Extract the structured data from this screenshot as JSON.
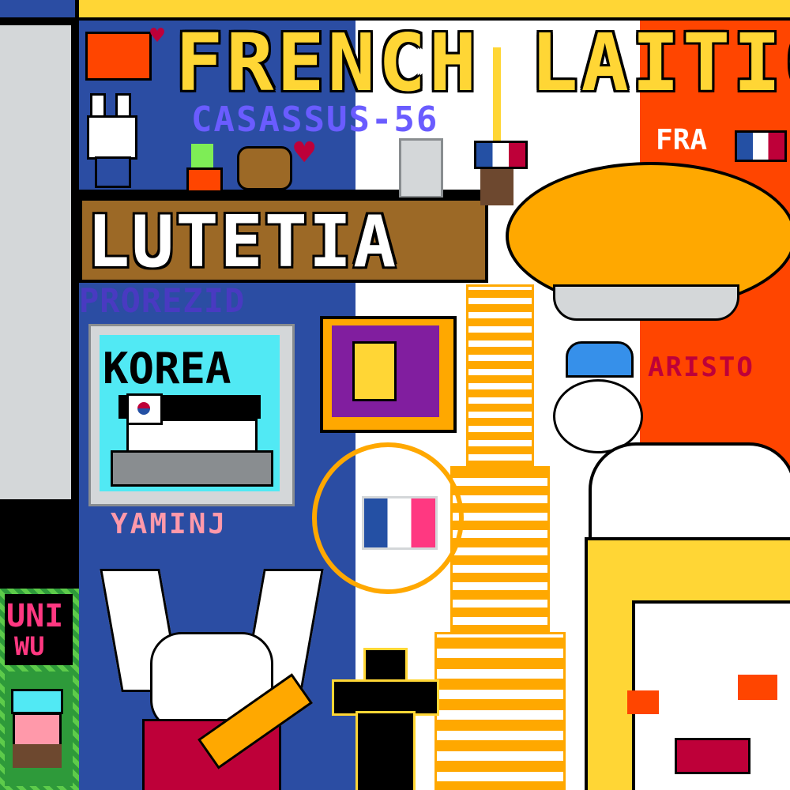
{
  "texts": {
    "banner_title": "FRENCH LAITICE",
    "subtitle": "CASASSUS-56",
    "lutetia": "LUTETIA",
    "pro_tag": "PROREZID",
    "korea_label": "KOREA",
    "korea_tag": "YAMINJ",
    "artist_tag": "ARISTO",
    "side_text_top": "UNI",
    "side_text_bottom": "WU",
    "fra_tag": "FRA"
  },
  "colors": {
    "french_blue": "#2b4da3",
    "french_white": "#ffffff",
    "french_red": "#ff4500",
    "eiffel_gold": "#ffa800",
    "banner_yellow": "#ffd635",
    "border_gray": "#898d90",
    "dark_bg": "#000000"
  },
  "icons": [
    "flag-icon",
    "heart-icon",
    "bunny-icon",
    "bear-icon",
    "plant-icon",
    "robot-icon",
    "eiffel-tower-icon",
    "baguette-icon",
    "croissant-icon",
    "blimp-icon",
    "hanbok-icon",
    "pagoda-icon",
    "creature-icon",
    "face-icon",
    "chess-piece-icon"
  ]
}
